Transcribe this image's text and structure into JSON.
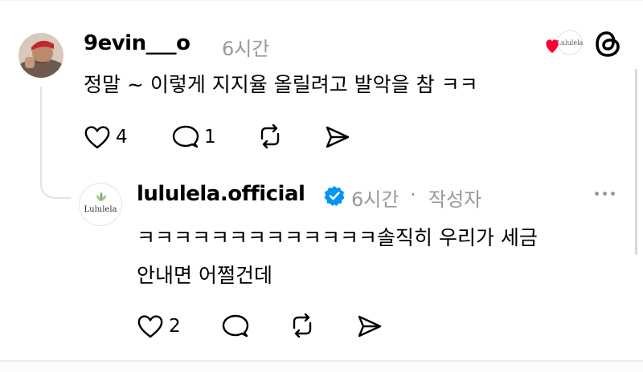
{
  "colors": {
    "muted": "#999999",
    "text": "#000000",
    "verified": "#0095f6",
    "heart": "#ff0034"
  },
  "post": {
    "username": "9evin___o",
    "time": "6시간",
    "text": "정말 ~ 이렇게 지지율 올릴려고 발악을 참 ㅋㅋ",
    "like_count": "4",
    "reply_count": "1",
    "icons": [
      "heart-outline-icon",
      "comment-icon",
      "repost-icon",
      "share-icon"
    ]
  },
  "header_icons": {
    "liked_badge": "heart-icon",
    "app_logo": "threads-logo-icon"
  },
  "reply": {
    "username": "lululela.official",
    "time": "6시간",
    "separator": "·",
    "author_tag": "작성자",
    "avatar_text": "Lululela",
    "line1": "ㅋㅋㅋㅋㅋㅋㅋㅋㅋㅋㅋㅋㅋ솔직히 우리가 세금",
    "line2": "안내면 어쩔건데",
    "like_count": "2",
    "icons": [
      "heart-outline-icon",
      "comment-icon",
      "repost-icon",
      "share-icon"
    ]
  }
}
